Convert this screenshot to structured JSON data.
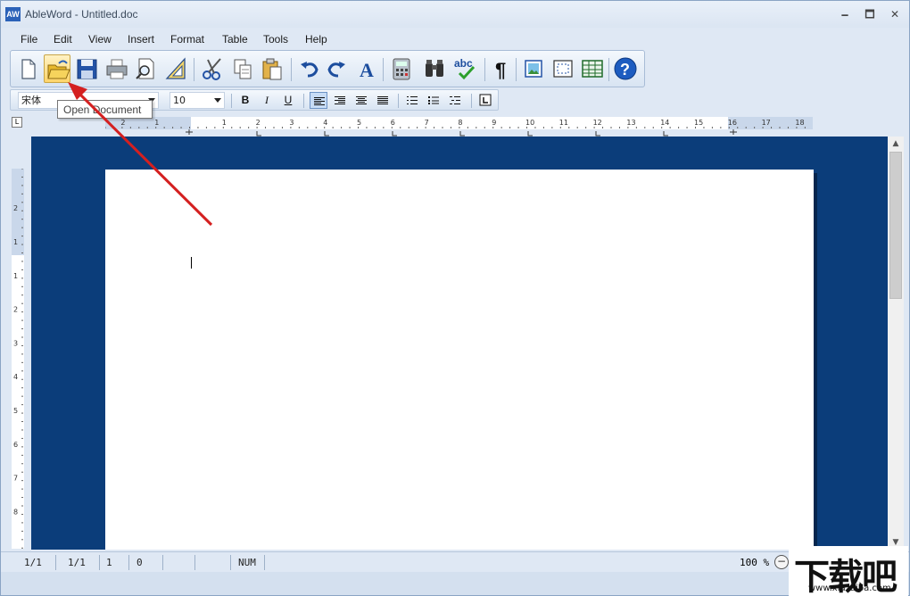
{
  "window": {
    "app_icon_text": "AW",
    "title": "AbleWord - Untitled.doc",
    "controls": {
      "minimize": "🗕",
      "restore": "🗖",
      "close": "✕"
    }
  },
  "menu": [
    "File",
    "Edit",
    "View",
    "Insert",
    "Format",
    "Table",
    "Tools",
    "Help"
  ],
  "toolbar": {
    "buttons": [
      "new-document-icon",
      "open-document-icon",
      "save-icon",
      "print-icon",
      "print-preview-icon",
      "page-setup-icon",
      "cut-icon",
      "copy-icon",
      "paste-icon",
      "undo-icon",
      "redo-icon",
      "font-icon",
      "calculator-icon",
      "find-icon",
      "spell-check-icon",
      "pilcrow-icon",
      "insert-image-icon",
      "insert-frame-icon",
      "insert-table-icon",
      "help-icon"
    ],
    "active_button": "open-document-icon",
    "spell_text": "abc",
    "pilcrow": "¶",
    "font_glyph": "A",
    "help_glyph": "?"
  },
  "format": {
    "font_name": "宋体",
    "font_size": "10",
    "bold": "B",
    "italic": "I",
    "underline": "U"
  },
  "tooltip": {
    "text": "Open Document"
  },
  "ruler": {
    "corner": "L",
    "labels": [
      "2",
      "1",
      "1",
      "2",
      "3",
      "4",
      "5",
      "6",
      "7",
      "8",
      "9",
      "10",
      "11",
      "12",
      "13",
      "14",
      "15",
      "16",
      "17",
      "18"
    ],
    "vlabels": [
      "2",
      "1",
      "1",
      "2",
      "3",
      "4",
      "5",
      "6",
      "7",
      "8"
    ]
  },
  "status": {
    "page": "1/1",
    "section": "1/1",
    "line": "1",
    "col": "0",
    "num": "NUM",
    "zoom": "100 %",
    "zoom_out": "−"
  },
  "watermark": {
    "text": "下载吧",
    "sub": "www.xiazaiba.com"
  }
}
